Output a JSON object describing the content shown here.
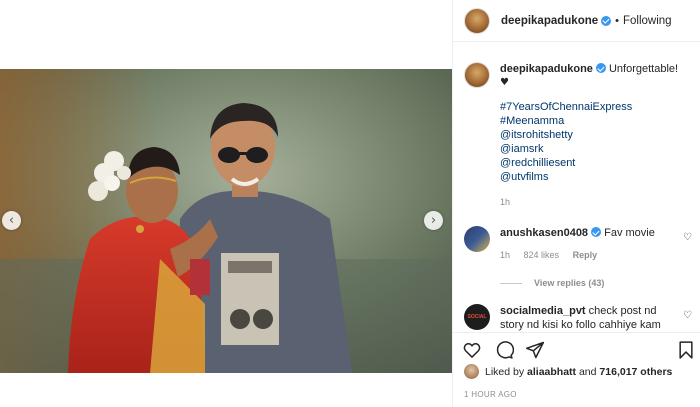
{
  "post": {
    "author": "deepikapadukone",
    "follow_status": "Following",
    "dot": "•"
  },
  "caption": {
    "author": "deepikapadukone",
    "text": "Unforgettable!",
    "heart": "♥",
    "tags": [
      "#7YearsOfChennaiExpress",
      "#Meenamma",
      "@itsrohitshetty",
      "@iamsrk",
      "@redchilliesent",
      "@utvfilms"
    ],
    "time": "1h"
  },
  "comments": [
    {
      "author": "anushkasen0408",
      "text": "Fav movie",
      "time": "1h",
      "likes": "824 likes",
      "reply_label": "Reply",
      "view_replies": "View replies (43)"
    },
    {
      "author": "socialmedia_pvt",
      "text": "check post nd story nd kisi ko follo cahhiye kam"
    }
  ],
  "likes": {
    "prefix": "Liked by",
    "liker": "aliaabhatt",
    "joiner": "and",
    "others": "716,017 others"
  },
  "timestamp": "1 HOUR AGO",
  "icons": {
    "prev": "chevron-left-icon",
    "next": "chevron-right-icon",
    "like": "heart-icon",
    "comment": "comment-icon",
    "share": "share-icon",
    "save": "bookmark-icon"
  },
  "colors": {
    "link": "#00376b",
    "verified": "#3897f0",
    "muted": "#8e8e8e"
  }
}
